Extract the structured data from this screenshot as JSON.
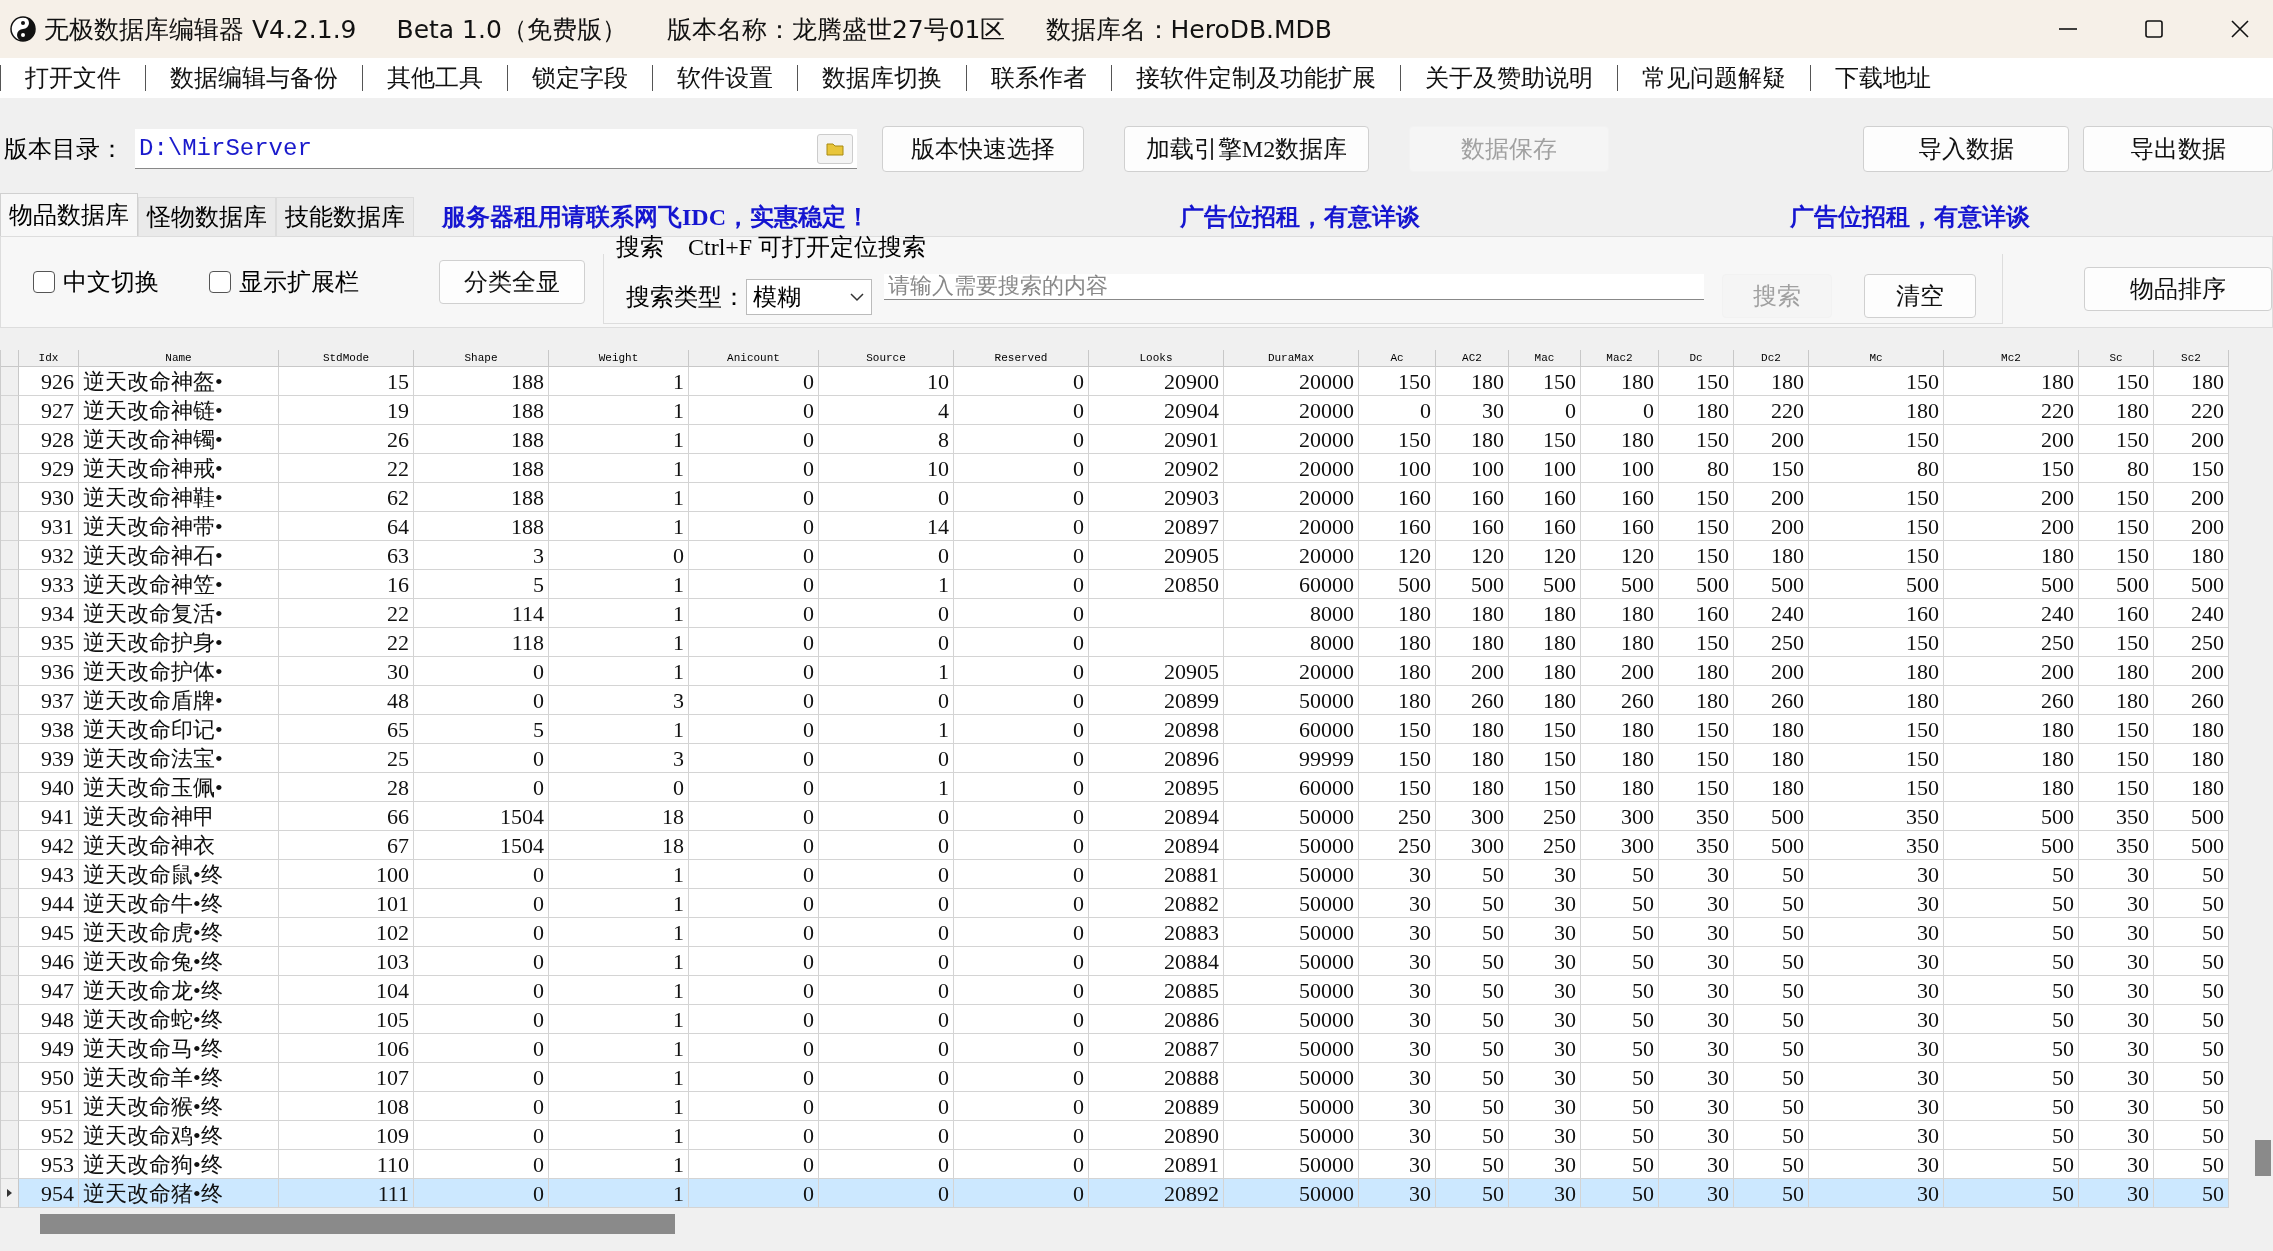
{
  "window": {
    "title": "无极数据库编辑器 V4.2.1.9",
    "edition": "Beta 1.0（免费版）",
    "version_name": "版本名称：龙腾盛世27号01区",
    "database_name": "数据库名：HeroDB.MDB"
  },
  "menu": [
    "打开文件",
    "数据编辑与备份",
    "其他工具",
    "锁定字段",
    "软件设置",
    "数据库切换",
    "联系作者",
    "接软件定制及功能扩展",
    "关于及赞助说明",
    "常见问题解疑",
    "下载地址"
  ],
  "toolbar": {
    "path_label": "版本目录：",
    "path_value": "D:\\MirServer",
    "buttons": [
      {
        "label": "版本快速选择",
        "disabled": false
      },
      {
        "label": "加载引擎M2数据库",
        "disabled": false
      },
      {
        "label": "数据保存",
        "disabled": true
      }
    ],
    "right_buttons": [
      {
        "label": "导入数据",
        "disabled": false
      },
      {
        "label": "导出数据",
        "disabled": false
      }
    ]
  },
  "tabs": [
    {
      "label": "物品数据库",
      "selected": true
    },
    {
      "label": "怪物数据库",
      "selected": false
    },
    {
      "label": "技能数据库",
      "selected": false
    }
  ],
  "ads": [
    "服务器租用请联系网飞IDC，实惠稳定！",
    "广告位招租，有意详谈",
    "广告位招租，有意详谈"
  ],
  "filters": {
    "checkboxes": [
      {
        "label": "中文切换",
        "checked": false
      },
      {
        "label": "显示扩展栏",
        "checked": false
      }
    ],
    "show_all_button": "分类全显",
    "search": {
      "title": "搜索　Ctrl+F 可打开定位搜索",
      "type_label": "搜索类型：",
      "type_value": "模糊",
      "placeholder": "请输入需要搜索的内容",
      "buttons": [
        {
          "label": "搜索",
          "disabled": true
        },
        {
          "label": "清空",
          "disabled": false
        }
      ]
    },
    "sort_button": "物品排序"
  },
  "table": {
    "columns": [
      "Idx",
      "Name",
      "StdMode",
      "Shape",
      "Weight",
      "Anicount",
      "Source",
      "Reserved",
      "Looks",
      "DuraMax",
      "Ac",
      "AC2",
      "Mac",
      "Mac2",
      "Dc",
      "Dc2",
      "Mc",
      "Mc2",
      "Sc",
      "Sc2"
    ],
    "rows": [
      {
        "selected": false,
        "cells": [
          "926",
          "逆天改命神盔•",
          "15",
          "188",
          "1",
          "0",
          "10",
          "0",
          "20900",
          "20000",
          "150",
          "180",
          "150",
          "180",
          "150",
          "180",
          "150",
          "180",
          "150",
          "180"
        ]
      },
      {
        "selected": false,
        "cells": [
          "927",
          "逆天改命神链•",
          "19",
          "188",
          "1",
          "0",
          "4",
          "0",
          "20904",
          "20000",
          "0",
          "30",
          "0",
          "0",
          "180",
          "220",
          "180",
          "220",
          "180",
          "220"
        ]
      },
      {
        "selected": false,
        "cells": [
          "928",
          "逆天改命神镯•",
          "26",
          "188",
          "1",
          "0",
          "8",
          "0",
          "20901",
          "20000",
          "150",
          "180",
          "150",
          "180",
          "150",
          "200",
          "150",
          "200",
          "150",
          "200"
        ]
      },
      {
        "selected": false,
        "cells": [
          "929",
          "逆天改命神戒•",
          "22",
          "188",
          "1",
          "0",
          "10",
          "0",
          "20902",
          "20000",
          "100",
          "100",
          "100",
          "100",
          "80",
          "150",
          "80",
          "150",
          "80",
          "150"
        ]
      },
      {
        "selected": false,
        "cells": [
          "930",
          "逆天改命神鞋•",
          "62",
          "188",
          "1",
          "0",
          "0",
          "0",
          "20903",
          "20000",
          "160",
          "160",
          "160",
          "160",
          "150",
          "200",
          "150",
          "200",
          "150",
          "200"
        ]
      },
      {
        "selected": false,
        "cells": [
          "931",
          "逆天改命神带•",
          "64",
          "188",
          "1",
          "0",
          "14",
          "0",
          "20897",
          "20000",
          "160",
          "160",
          "160",
          "160",
          "150",
          "200",
          "150",
          "200",
          "150",
          "200"
        ]
      },
      {
        "selected": false,
        "cells": [
          "932",
          "逆天改命神石•",
          "63",
          "3",
          "0",
          "0",
          "0",
          "0",
          "20905",
          "20000",
          "120",
          "120",
          "120",
          "120",
          "150",
          "180",
          "150",
          "180",
          "150",
          "180"
        ]
      },
      {
        "selected": false,
        "cells": [
          "933",
          "逆天改命神笠•",
          "16",
          "5",
          "1",
          "0",
          "1",
          "0",
          "20850",
          "60000",
          "500",
          "500",
          "500",
          "500",
          "500",
          "500",
          "500",
          "500",
          "500",
          "500"
        ]
      },
      {
        "selected": false,
        "cells": [
          "934",
          "逆天改命复活•",
          "22",
          "114",
          "1",
          "0",
          "0",
          "0",
          null,
          "8000",
          "180",
          "180",
          "180",
          "180",
          "160",
          "240",
          "160",
          "240",
          "160",
          "240"
        ]
      },
      {
        "selected": false,
        "cells": [
          "935",
          "逆天改命护身•",
          "22",
          "118",
          "1",
          "0",
          "0",
          "0",
          null,
          "8000",
          "180",
          "180",
          "180",
          "180",
          "150",
          "250",
          "150",
          "250",
          "150",
          "250"
        ]
      },
      {
        "selected": false,
        "cells": [
          "936",
          "逆天改命护体•",
          "30",
          "0",
          "1",
          "0",
          "1",
          "0",
          "20905",
          "20000",
          "180",
          "200",
          "180",
          "200",
          "180",
          "200",
          "180",
          "200",
          "180",
          "200"
        ]
      },
      {
        "selected": false,
        "cells": [
          "937",
          "逆天改命盾牌•",
          "48",
          "0",
          "3",
          "0",
          "0",
          "0",
          "20899",
          "50000",
          "180",
          "260",
          "180",
          "260",
          "180",
          "260",
          "180",
          "260",
          "180",
          "260"
        ]
      },
      {
        "selected": false,
        "cells": [
          "938",
          "逆天改命印记•",
          "65",
          "5",
          "1",
          "0",
          "1",
          "0",
          "20898",
          "60000",
          "150",
          "180",
          "150",
          "180",
          "150",
          "180",
          "150",
          "180",
          "150",
          "180"
        ]
      },
      {
        "selected": false,
        "cells": [
          "939",
          "逆天改命法宝•",
          "25",
          "0",
          "3",
          "0",
          "0",
          "0",
          "20896",
          "99999",
          "150",
          "180",
          "150",
          "180",
          "150",
          "180",
          "150",
          "180",
          "150",
          "180"
        ]
      },
      {
        "selected": false,
        "cells": [
          "940",
          "逆天改命玉佩•",
          "28",
          "0",
          "0",
          "0",
          "1",
          "0",
          "20895",
          "60000",
          "150",
          "180",
          "150",
          "180",
          "150",
          "180",
          "150",
          "180",
          "150",
          "180"
        ]
      },
      {
        "selected": false,
        "cells": [
          "941",
          "逆天改命神甲",
          "66",
          "1504",
          "18",
          "0",
          "0",
          "0",
          "20894",
          "50000",
          "250",
          "300",
          "250",
          "300",
          "350",
          "500",
          "350",
          "500",
          "350",
          "500"
        ]
      },
      {
        "selected": false,
        "cells": [
          "942",
          "逆天改命神衣",
          "67",
          "1504",
          "18",
          "0",
          "0",
          "0",
          "20894",
          "50000",
          "250",
          "300",
          "250",
          "300",
          "350",
          "500",
          "350",
          "500",
          "350",
          "500"
        ]
      },
      {
        "selected": false,
        "cells": [
          "943",
          "逆天改命鼠•终",
          "100",
          "0",
          "1",
          "0",
          "0",
          "0",
          "20881",
          "50000",
          "30",
          "50",
          "30",
          "50",
          "30",
          "50",
          "30",
          "50",
          "30",
          "50"
        ]
      },
      {
        "selected": false,
        "cells": [
          "944",
          "逆天改命牛•终",
          "101",
          "0",
          "1",
          "0",
          "0",
          "0",
          "20882",
          "50000",
          "30",
          "50",
          "30",
          "50",
          "30",
          "50",
          "30",
          "50",
          "30",
          "50"
        ]
      },
      {
        "selected": false,
        "cells": [
          "945",
          "逆天改命虎•终",
          "102",
          "0",
          "1",
          "0",
          "0",
          "0",
          "20883",
          "50000",
          "30",
          "50",
          "30",
          "50",
          "30",
          "50",
          "30",
          "50",
          "30",
          "50"
        ]
      },
      {
        "selected": false,
        "cells": [
          "946",
          "逆天改命兔•终",
          "103",
          "0",
          "1",
          "0",
          "0",
          "0",
          "20884",
          "50000",
          "30",
          "50",
          "30",
          "50",
          "30",
          "50",
          "30",
          "50",
          "30",
          "50"
        ]
      },
      {
        "selected": false,
        "cells": [
          "947",
          "逆天改命龙•终",
          "104",
          "0",
          "1",
          "0",
          "0",
          "0",
          "20885",
          "50000",
          "30",
          "50",
          "30",
          "50",
          "30",
          "50",
          "30",
          "50",
          "30",
          "50"
        ]
      },
      {
        "selected": false,
        "cells": [
          "948",
          "逆天改命蛇•终",
          "105",
          "0",
          "1",
          "0",
          "0",
          "0",
          "20886",
          "50000",
          "30",
          "50",
          "30",
          "50",
          "30",
          "50",
          "30",
          "50",
          "30",
          "50"
        ]
      },
      {
        "selected": false,
        "cells": [
          "949",
          "逆天改命马•终",
          "106",
          "0",
          "1",
          "0",
          "0",
          "0",
          "20887",
          "50000",
          "30",
          "50",
          "30",
          "50",
          "30",
          "50",
          "30",
          "50",
          "30",
          "50"
        ]
      },
      {
        "selected": false,
        "cells": [
          "950",
          "逆天改命羊•终",
          "107",
          "0",
          "1",
          "0",
          "0",
          "0",
          "20888",
          "50000",
          "30",
          "50",
          "30",
          "50",
          "30",
          "50",
          "30",
          "50",
          "30",
          "50"
        ]
      },
      {
        "selected": false,
        "cells": [
          "951",
          "逆天改命猴•终",
          "108",
          "0",
          "1",
          "0",
          "0",
          "0",
          "20889",
          "50000",
          "30",
          "50",
          "30",
          "50",
          "30",
          "50",
          "30",
          "50",
          "30",
          "50"
        ]
      },
      {
        "selected": false,
        "cells": [
          "952",
          "逆天改命鸡•终",
          "109",
          "0",
          "1",
          "0",
          "0",
          "0",
          "20890",
          "50000",
          "30",
          "50",
          "30",
          "50",
          "30",
          "50",
          "30",
          "50",
          "30",
          "50"
        ]
      },
      {
        "selected": false,
        "cells": [
          "953",
          "逆天改命狗•终",
          "110",
          "0",
          "1",
          "0",
          "0",
          "0",
          "20891",
          "50000",
          "30",
          "50",
          "30",
          "50",
          "30",
          "50",
          "30",
          "50",
          "30",
          "50"
        ]
      },
      {
        "selected": true,
        "cells": [
          "954",
          "逆天改命猪•终",
          "111",
          "0",
          "1",
          "0",
          "0",
          "0",
          "20892",
          "50000",
          "30",
          "50",
          "30",
          "50",
          "30",
          "50",
          "30",
          "50",
          "30",
          "50"
        ]
      }
    ]
  }
}
